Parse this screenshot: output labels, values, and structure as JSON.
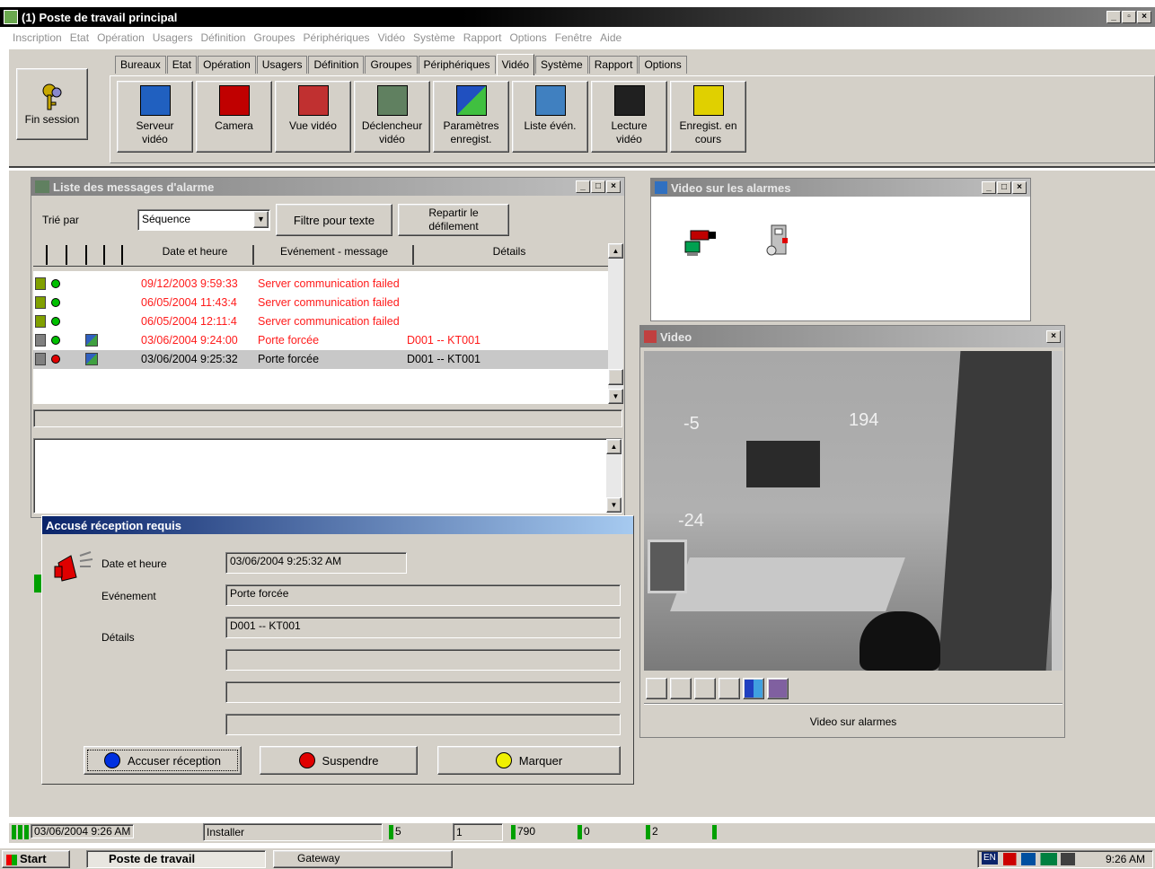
{
  "window": {
    "title": "(1) Poste de travail principal"
  },
  "menu": [
    "Inscription",
    "Etat",
    "Opération",
    "Usagers",
    "Définition",
    "Groupes",
    "Périphériques",
    "Vidéo",
    "Système",
    "Rapport",
    "Options",
    "Fenêtre",
    "Aide"
  ],
  "tabs": [
    "Bureaux",
    "Etat",
    "Opération",
    "Usagers",
    "Définition",
    "Groupes",
    "Périphériques",
    "Vidéo",
    "Système",
    "Rapport",
    "Options"
  ],
  "active_tab": "Vidéo",
  "session": {
    "label": "Fin session"
  },
  "toolbar": [
    {
      "line1": "Serveur",
      "line2": "vidéo",
      "icon": "server-video-icon"
    },
    {
      "line1": "Camera",
      "line2": "",
      "icon": "camera-icon"
    },
    {
      "line1": "Vue vidéo",
      "line2": "",
      "icon": "video-view-icon"
    },
    {
      "line1": "Déclencheur",
      "line2": "vidéo",
      "icon": "video-trigger-icon"
    },
    {
      "line1": "Paramètres",
      "line2": "enregist.",
      "icon": "film-icon"
    },
    {
      "line1": "Liste évén.",
      "line2": "",
      "icon": "event-list-icon"
    },
    {
      "line1": "Lecture",
      "line2": "vidéo",
      "icon": "clapper-play-icon"
    },
    {
      "line1": "Enregist. en",
      "line2": "cours",
      "icon": "clapper-record-icon"
    }
  ],
  "alarm_list": {
    "title": "Liste des messages d'alarme",
    "sort_label": "Trié par",
    "sort_value": "Séquence",
    "filter_button": "Filtre pour texte",
    "scroll_button_line1": "Repartir le",
    "scroll_button_line2": "défilement",
    "columns": [
      "Date et heure",
      "Evénement - message",
      "Détails"
    ],
    "rows": [
      {
        "datetime": "09/12/2003 9:59:33",
        "event": "Server communication failed",
        "details": "",
        "color": "#ff1a1a",
        "status": "#00c000",
        "icon": "keys-icon",
        "video": false,
        "selected": false
      },
      {
        "datetime": "06/05/2004 11:43:4",
        "event": "Server communication failed",
        "details": "",
        "color": "#ff1a1a",
        "status": "#00c000",
        "icon": "keys-icon",
        "video": false,
        "selected": false
      },
      {
        "datetime": "06/05/2004 12:11:4",
        "event": "Server communication failed",
        "details": "",
        "color": "#ff1a1a",
        "status": "#00c000",
        "icon": "keys-icon",
        "video": false,
        "selected": false
      },
      {
        "datetime": "03/06/2004 9:24:00",
        "event": "Porte forcée",
        "details": "D001 -- KT001",
        "color": "#ff1a1a",
        "status": "#00c000",
        "icon": "door-icon",
        "video": true,
        "selected": false
      },
      {
        "datetime": "03/06/2004 9:25:32",
        "event": "Porte forcée",
        "details": "D001 -- KT001",
        "color": "#000000",
        "status": "#e00000",
        "icon": "door-icon",
        "video": true,
        "selected": true
      }
    ]
  },
  "video_alarms": {
    "title": "Video sur les alarmes"
  },
  "video": {
    "title": "Video",
    "footer": "Video sur alarmes",
    "overlay_left": "-5",
    "overlay_mid": "194",
    "overlay_low": "-24"
  },
  "ack": {
    "title": "Accusé réception requis",
    "date_label": "Date et heure",
    "date_value": "03/06/2004 9:25:32 AM",
    "event_label": "Evénement",
    "event_value": "Porte forcée",
    "details_label": "Détails",
    "details_value": "D001 -- KT001",
    "btn_ack": "Accuser réception",
    "btn_suspend": "Suspendre",
    "btn_mark": "Marquer"
  },
  "statusbar": {
    "datetime": "03/06/2004 9:26 AM",
    "user": "Installer",
    "c1": "5",
    "c2": "1",
    "c3": "790",
    "c4": "0",
    "c5": "2"
  },
  "taskbar": {
    "start": "Start",
    "task1": "Poste de travail",
    "task2": "Gateway",
    "lang": "EN",
    "clock": "9:26 AM"
  },
  "colors": {
    "titlebar": "#0a246a",
    "alarm_text": "#ff1a1a",
    "face": "#d4d0c8"
  }
}
